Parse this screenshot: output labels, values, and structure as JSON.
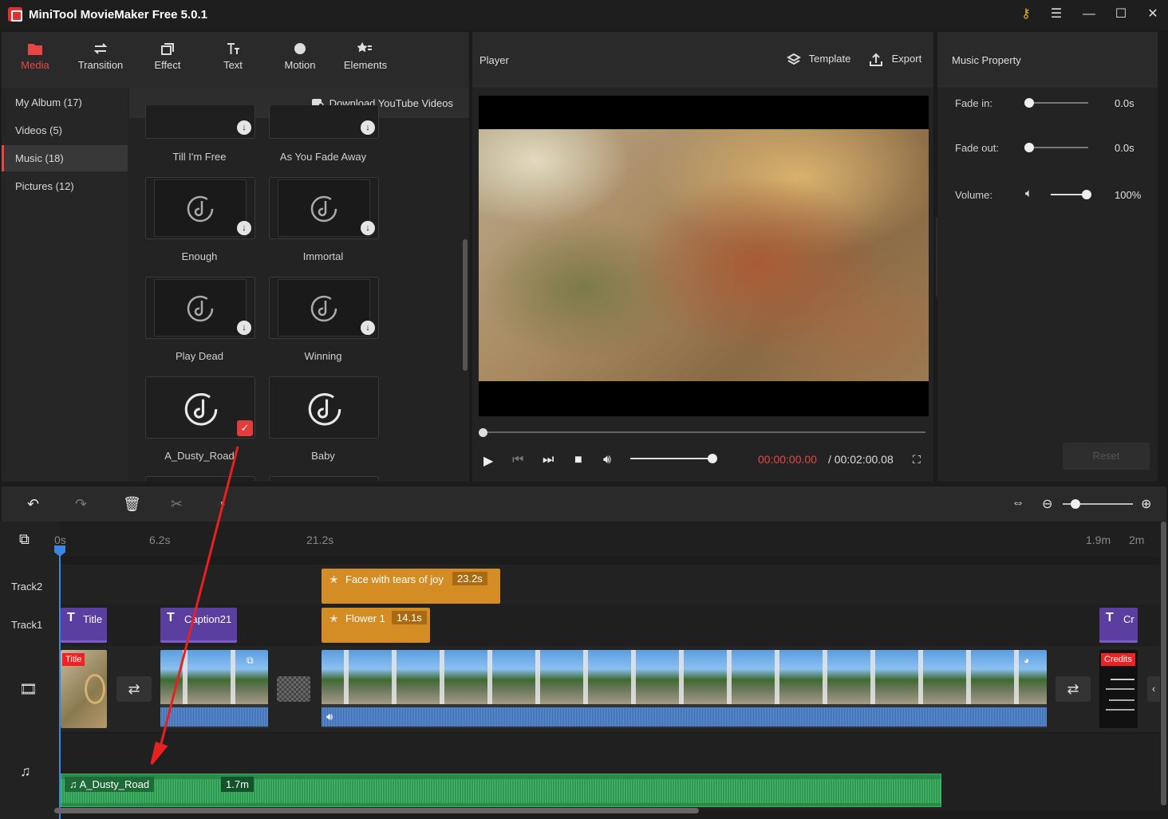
{
  "window": {
    "title": "MiniTool MovieMaker Free 5.0.1"
  },
  "media_tabs": [
    {
      "label": "Media",
      "icon": "folder-icon",
      "active": true
    },
    {
      "label": "Transition",
      "icon": "swap-arrows-icon"
    },
    {
      "label": "Effect",
      "icon": "layers-icon"
    },
    {
      "label": "Text",
      "icon": "text-icon"
    },
    {
      "label": "Motion",
      "icon": "motion-icon"
    },
    {
      "label": "Elements",
      "icon": "star-list-icon"
    }
  ],
  "albums": [
    {
      "label": "My Album (17)"
    },
    {
      "label": "Videos (5)"
    },
    {
      "label": "Music (18)",
      "active": true
    },
    {
      "label": "Pictures (12)"
    }
  ],
  "download_label": "Download YouTube Videos",
  "music_items": [
    {
      "name": "Till I'm Free"
    },
    {
      "name": "As You Fade Away"
    },
    {
      "name": "Enough"
    },
    {
      "name": "Immortal"
    },
    {
      "name": "Play Dead"
    },
    {
      "name": "Winning"
    },
    {
      "name": "A_Dusty_Road",
      "selected": true
    },
    {
      "name": "Baby"
    }
  ],
  "player": {
    "title": "Player",
    "template_label": "Template",
    "export_label": "Export",
    "time_current": "00:00:00.00",
    "time_total": "/ 00:02:00.08"
  },
  "property": {
    "title": "Music Property",
    "fade_in_label": "Fade in:",
    "fade_in_value": "0.0s",
    "fade_out_label": "Fade out:",
    "fade_out_value": "0.0s",
    "volume_label": "Volume:",
    "volume_value": "100%",
    "reset_label": "Reset"
  },
  "timeline": {
    "ticks": [
      "0s",
      "6.2s",
      "21.2s",
      "1.9m",
      "2m"
    ],
    "track2_label": "Track2",
    "track1_label": "Track1",
    "track2_clips": [
      {
        "label": "Face with tears of joy",
        "duration": "23.2s"
      }
    ],
    "track1_clips": [
      {
        "label": "Title"
      },
      {
        "label": "Caption21"
      },
      {
        "label": "Flower 1",
        "duration": "14.1s"
      },
      {
        "label": "Cr"
      }
    ],
    "video_badges": {
      "title": "Title",
      "credits": "Credits"
    },
    "music_clip": {
      "label": "A_Dusty_Road",
      "duration": "1.7m"
    }
  },
  "colors": {
    "accent": "#e84545",
    "music_clip": "#2a8a4a",
    "text_clip": "#5b3fa0",
    "element_clip": "#d48c24",
    "playhead": "#3a86e0"
  }
}
